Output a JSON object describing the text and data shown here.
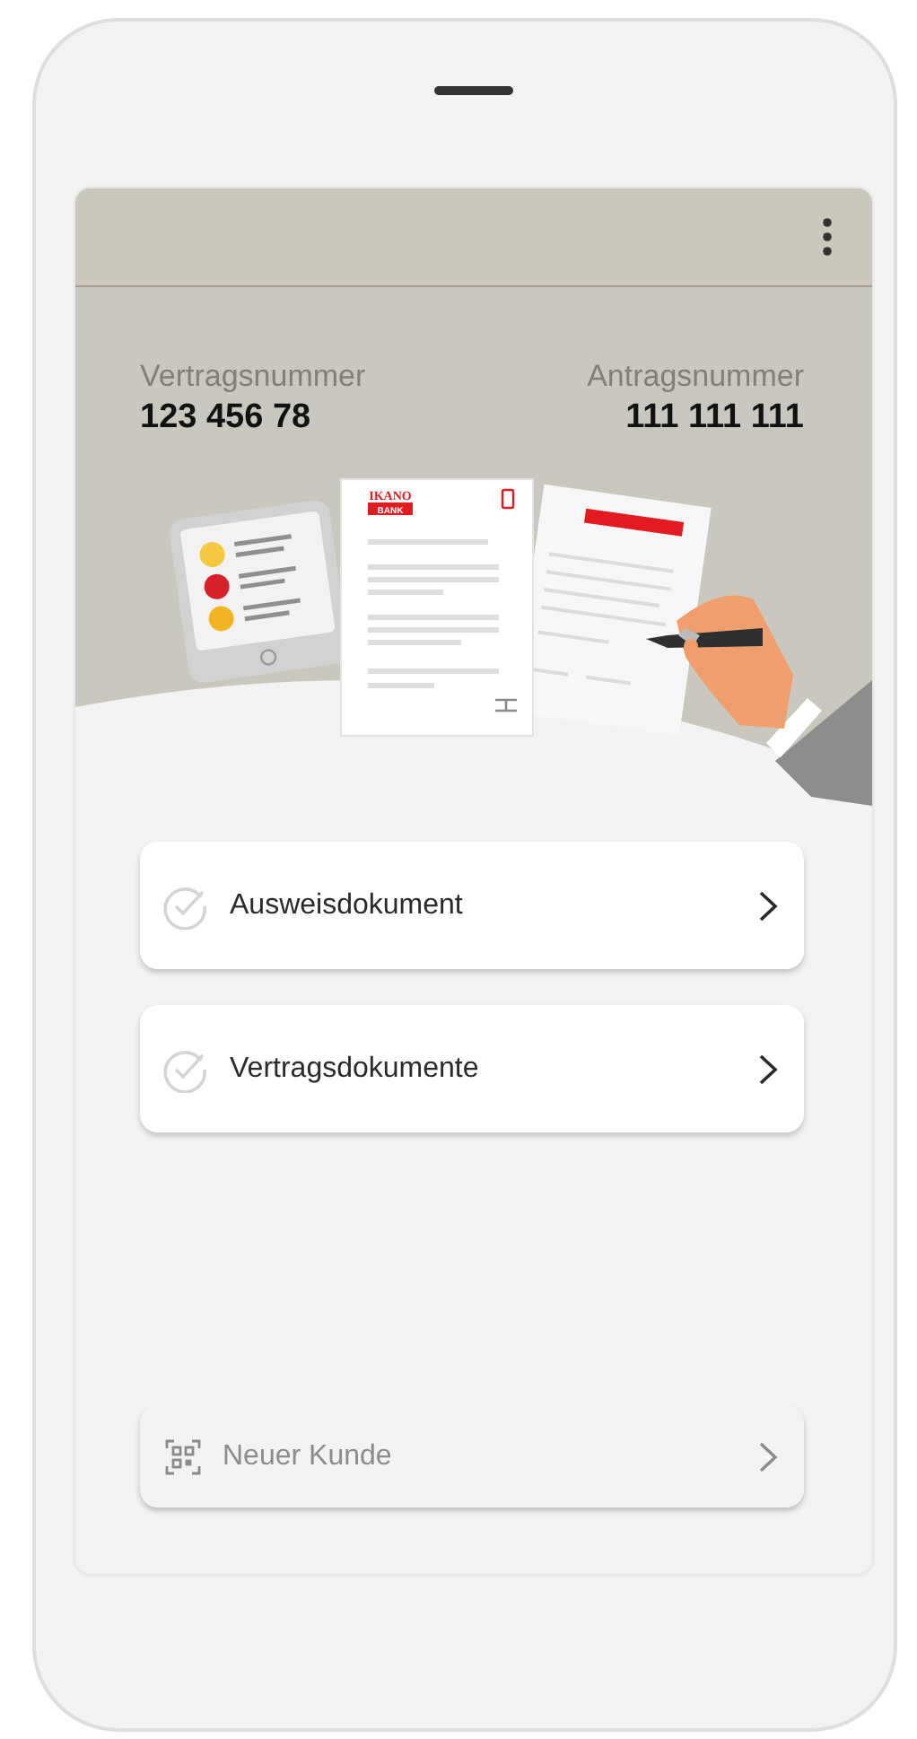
{
  "contract": {
    "left_label": "Vertragsnummer",
    "left_value": "123 456 78",
    "right_label": "Antragsnummer",
    "right_value": "111 111 111"
  },
  "illustration": {
    "logo_lines": [
      "IKANO",
      "BANK"
    ]
  },
  "items": [
    {
      "kind": "document",
      "label": "Ausweisdokument",
      "checked": false,
      "disabled": false
    },
    {
      "kind": "document",
      "label": "Vertragsdokumente",
      "checked": false,
      "disabled": false
    }
  ],
  "footer_item": {
    "kind": "scan",
    "label": "Neuer Kunde",
    "disabled": true
  }
}
